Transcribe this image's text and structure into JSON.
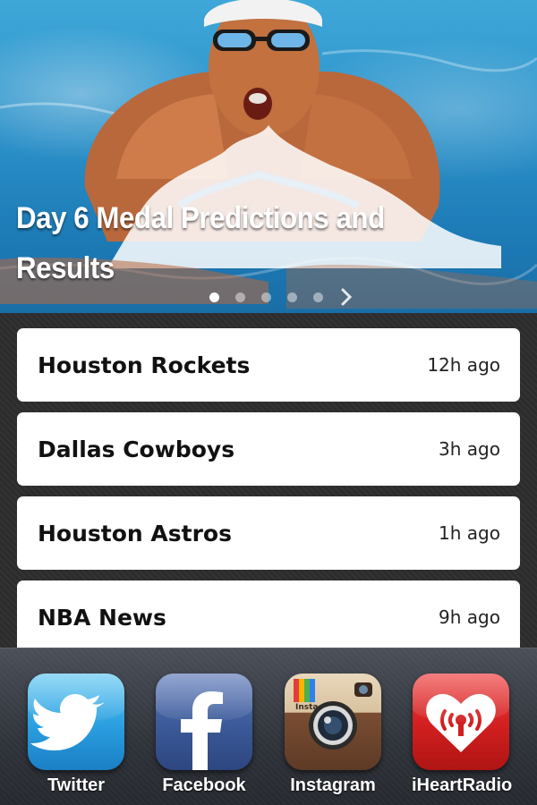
{
  "hero": {
    "title": "Day 6 Medal Predictions and Results",
    "image": "swimmer-butterfly-photo",
    "pager": {
      "total": 5,
      "active": 0,
      "next_icon": "chevron-right-icon"
    }
  },
  "feed": {
    "items": [
      {
        "title": "Houston Rockets",
        "time": "12h ago"
      },
      {
        "title": "Dallas Cowboys",
        "time": "3h ago"
      },
      {
        "title": "Houston Astros",
        "time": "1h ago"
      },
      {
        "title": "NBA News",
        "time": "9h ago"
      }
    ]
  },
  "dock": {
    "apps": [
      {
        "label": "Twitter",
        "icon": "twitter-bird-icon",
        "color": "#2a9ee0"
      },
      {
        "label": "Facebook",
        "icon": "facebook-f-icon",
        "color": "#3b5998"
      },
      {
        "label": "Instagram",
        "icon": "instagram-camera-icon",
        "color": "#7a4d33"
      },
      {
        "label": "iHeartRadio",
        "icon": "iheartradio-icon",
        "color": "#d11f1f"
      }
    ]
  }
}
